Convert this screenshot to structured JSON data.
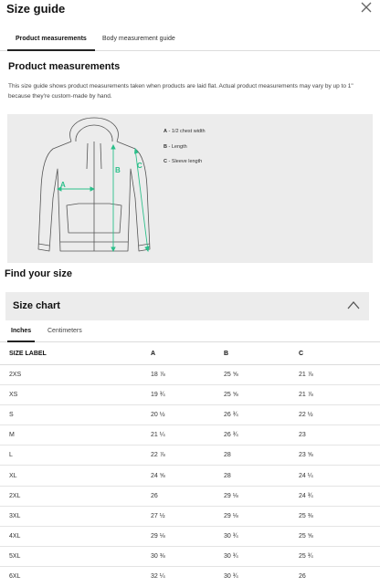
{
  "modal": {
    "title": "Size guide"
  },
  "tabs": [
    {
      "label": "Product measurements",
      "active": true
    },
    {
      "label": "Body measurement guide",
      "active": false
    }
  ],
  "product": {
    "heading": "Product measurements",
    "description": "This size guide shows product measurements taken when products are laid flat. Actual product measurements may vary by up to 1\" because they're custom-made by hand."
  },
  "illustration": {
    "legend": [
      {
        "key": "A",
        "text": " - 1/2 chest width"
      },
      {
        "key": "B",
        "text": " -  Length"
      },
      {
        "key": "C",
        "text": " - Sleeve length"
      }
    ],
    "markers": {
      "a": "A",
      "b": "B",
      "c": "C"
    }
  },
  "find": {
    "heading": "Find your size"
  },
  "size_chart": {
    "heading": "Size chart",
    "unit_tabs": [
      {
        "label": "Inches",
        "active": true
      },
      {
        "label": "Centimeters",
        "active": false
      }
    ],
    "columns": [
      "SIZE LABEL",
      "A",
      "B",
      "C"
    ],
    "rows": [
      [
        "2XS",
        "18 ⅞",
        "25 ⅝",
        "21 ⅞"
      ],
      [
        "XS",
        "19 ¾",
        "25 ⅝",
        "21 ⅞"
      ],
      [
        "S",
        "20 ½",
        "26 ¾",
        "22 ½"
      ],
      [
        "M",
        "21 ¼",
        "26 ¾",
        "23"
      ],
      [
        "L",
        "22 ⅞",
        "28",
        "23 ⅝"
      ],
      [
        "XL",
        "24 ⅝",
        "28",
        "24 ¼"
      ],
      [
        "2XL",
        "26",
        "29 ⅛",
        "24 ¾"
      ],
      [
        "3XL",
        "27 ½",
        "29 ⅛",
        "25 ⅜"
      ],
      [
        "4XL",
        "29 ⅛",
        "30 ¾",
        "25 ⅝"
      ],
      [
        "5XL",
        "30 ⅜",
        "30 ¾",
        "25 ¾"
      ],
      [
        "6XL",
        "32 ¼",
        "30 ¾",
        "26"
      ]
    ]
  },
  "colors": {
    "accent": "#2bbf8a",
    "panel": "#ececec",
    "text": "#111111"
  }
}
